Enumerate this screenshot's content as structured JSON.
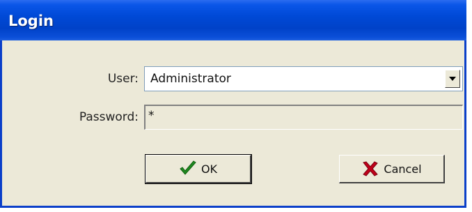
{
  "window": {
    "title": "Login"
  },
  "form": {
    "user_label": "User:",
    "user_value": "Administrator",
    "password_label": "Password:",
    "password_value": "*"
  },
  "buttons": {
    "ok_label": "OK",
    "cancel_label": "Cancel"
  },
  "icons": {
    "ok": "check-icon",
    "cancel": "x-icon",
    "dropdown": "chevron-down-icon"
  },
  "colors": {
    "titlebar": "#0049d6",
    "dialog_bg": "#ece9d8",
    "check": "#1f8a1f",
    "cross": "#c0001a"
  }
}
